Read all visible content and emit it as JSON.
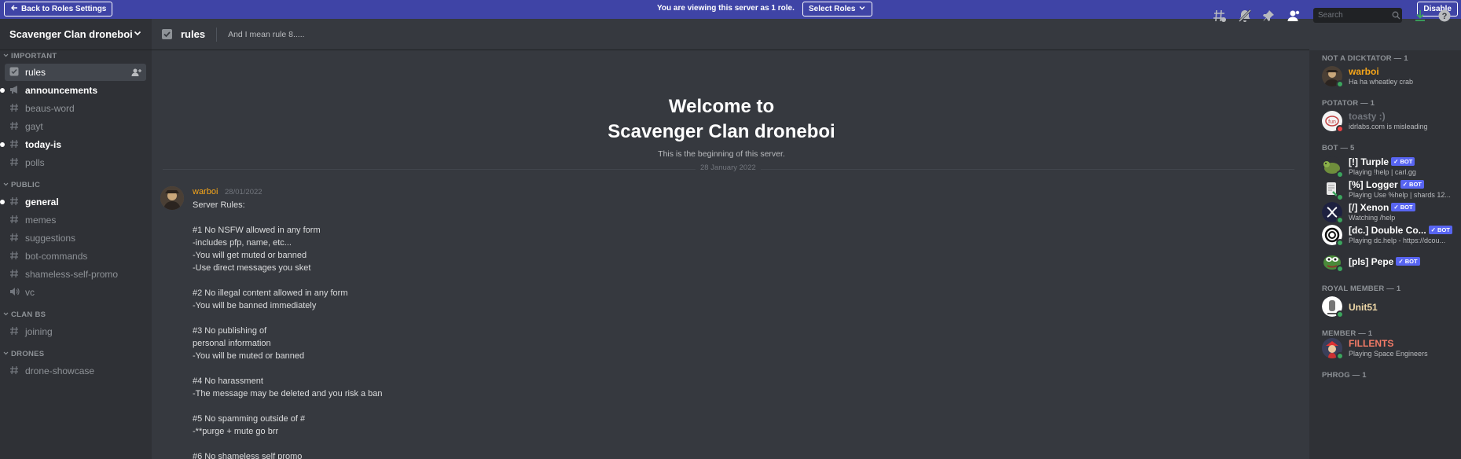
{
  "banner": {
    "back_label": "Back to Roles Settings",
    "message": "You are viewing this server as 1 role.",
    "select_roles_label": "Select Roles",
    "disable_label": "Disable"
  },
  "server": {
    "name": "Scavenger Clan droneboi"
  },
  "sidebar": {
    "categories": [
      {
        "name": "IMPORTANT"
      },
      {
        "name": "PUBLIC"
      },
      {
        "name": "CLAN BS"
      },
      {
        "name": "DRONES"
      }
    ],
    "channels": [
      {
        "name": "rules",
        "icon": "rules-checkbox-icon",
        "state": "active"
      },
      {
        "name": "announcements",
        "icon": "megaphone-icon",
        "state": "unread"
      },
      {
        "name": "beaus-word",
        "icon": "hash-icon",
        "state": "normal"
      },
      {
        "name": "gayt",
        "icon": "hash-icon",
        "state": "normal"
      },
      {
        "name": "today-is",
        "icon": "hash-icon",
        "state": "unread"
      },
      {
        "name": "polls",
        "icon": "hash-icon",
        "state": "normal"
      },
      {
        "name": "general",
        "icon": "hash-icon",
        "state": "unread"
      },
      {
        "name": "memes",
        "icon": "hash-icon",
        "state": "normal"
      },
      {
        "name": "suggestions",
        "icon": "hash-icon",
        "state": "normal"
      },
      {
        "name": "bot-commands",
        "icon": "hash-icon",
        "state": "normal"
      },
      {
        "name": "shameless-self-promo",
        "icon": "hash-icon",
        "state": "normal"
      },
      {
        "name": "vc",
        "icon": "speaker-icon",
        "state": "normal"
      },
      {
        "name": "joining",
        "icon": "hash-icon",
        "state": "normal"
      },
      {
        "name": "drone-showcase",
        "icon": "hash-icon",
        "state": "normal"
      }
    ]
  },
  "header": {
    "channel": "rules",
    "topic": "And I mean rule 8.....",
    "search_placeholder": "Search",
    "icons": [
      "threads-icon",
      "mute-bell-icon",
      "pin-icon",
      "members-icon",
      "download-icon",
      "help-icon"
    ]
  },
  "welcome": {
    "title_line1": "Welcome to",
    "title_line2": "Scavenger Clan droneboi",
    "subtitle": "This is the beginning of this server."
  },
  "date_divider": "28 January 2022",
  "message": {
    "author": "warboi",
    "timestamp": "28/01/2022",
    "lines": [
      "Server Rules:",
      "",
      "#1 No NSFW allowed in any form",
      "-includes pfp, name, etc...",
      "-You will get muted or banned",
      "-Use direct messages you sket",
      "",
      "#2 No illegal content allowed in any form",
      "-You will be banned immediately",
      "",
      "#3 No publishing of",
      "personal information",
      "-You will be muted or banned",
      "",
      "#4 No harassment",
      "-The message may be deleted and you risk a ban",
      "",
      "#5 No spamming outside of #",
      "-**purge + mute go brr",
      "",
      "#6 No shameless self promo"
    ]
  },
  "members": {
    "groups": [
      {
        "label": "NOT A DICKTATOR — 1"
      },
      {
        "label": "POTATOR — 1"
      },
      {
        "label": "BOT — 5"
      },
      {
        "label": "ROYAL MEMBER — 1"
      },
      {
        "label": "MEMBER — 1"
      },
      {
        "label": "PHROG — 1"
      }
    ],
    "list": [
      {
        "name": "warboi",
        "activity": "Ha ha wheatley crab",
        "color": "#f6a61a",
        "status": "#3ba55d"
      },
      {
        "name": "toasty :)",
        "activity": "idrlabs.com is misleading",
        "color": "#72767d",
        "status": "#ed4245"
      },
      {
        "name": "[!] Turple",
        "activity": "Playing !help | carl.gg",
        "color": "#ffffff",
        "status": "#3ba55d",
        "bot": "✓ BOT"
      },
      {
        "name": "[%] Logger",
        "activity": "Playing Use %help | shards 12...",
        "color": "#ffffff",
        "status": "#3ba55d",
        "bot": "✓ BOT"
      },
      {
        "name": "[/] Xenon",
        "activity": "Watching /help",
        "color": "#ffffff",
        "status": "#3ba55d",
        "bot": "✓ BOT"
      },
      {
        "name": "[dc.] Double Co...",
        "activity": "Playing dc.help - https://dcou...",
        "color": "#ffffff",
        "status": "#3ba55d",
        "bot": "✓ BOT"
      },
      {
        "name": "[pls] Pepe",
        "activity": "",
        "color": "#ffffff",
        "status": "#3ba55d",
        "bot": "✓ BOT"
      },
      {
        "name": "Unit51",
        "activity": "",
        "color": "#f0d9a8",
        "status": "#3ba55d"
      },
      {
        "name": "FILLENTS",
        "activity": "Playing Space Engineers",
        "color": "#f47b67",
        "status": "#3ba55d"
      }
    ]
  }
}
